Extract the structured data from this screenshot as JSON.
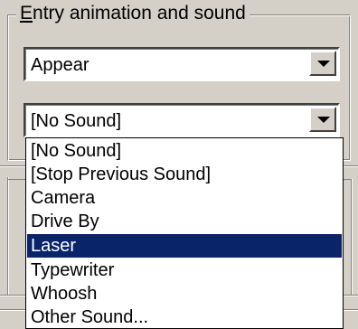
{
  "groupbox": {
    "title": "Entry animation and sound"
  },
  "animation_select": {
    "value": "Appear"
  },
  "sound_select": {
    "value": "[No Sound]"
  },
  "sound_options": [
    {
      "label": "[No Sound]",
      "selected": false
    },
    {
      "label": "[Stop Previous Sound]",
      "selected": false
    },
    {
      "label": "Camera",
      "selected": false
    },
    {
      "label": "Drive By",
      "selected": false
    },
    {
      "label": "Laser",
      "selected": true
    },
    {
      "label": "Typewriter",
      "selected": false
    },
    {
      "label": "Whoosh",
      "selected": false
    },
    {
      "label": "Other Sound...",
      "selected": false
    }
  ],
  "colors": {
    "dialog_bg": "#d4d0c8",
    "selection_bg": "#0a246a",
    "selection_fg": "#ffffff"
  }
}
